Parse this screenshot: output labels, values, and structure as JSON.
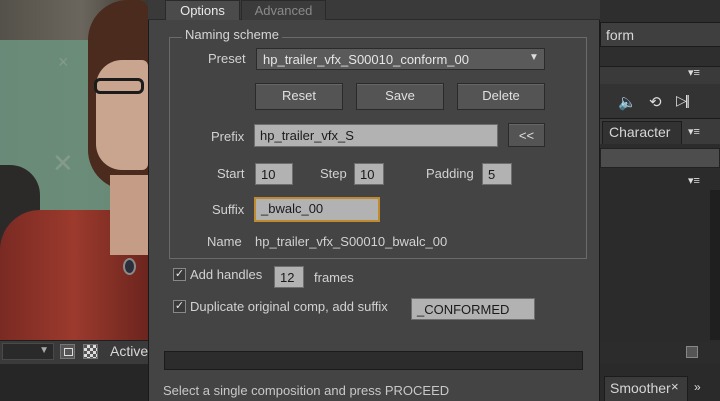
{
  "dialog": {
    "tabs": [
      {
        "label": "Options",
        "active": true
      },
      {
        "label": "Advanced",
        "active": false
      }
    ],
    "naming_scheme": {
      "title": "Naming scheme",
      "preset_label": "Preset",
      "preset_value": "hp_trailer_vfx_S00010_conform_00",
      "buttons": {
        "reset": "Reset",
        "save": "Save",
        "delete": "Delete"
      },
      "prefix_label": "Prefix",
      "prefix_value": "hp_trailer_vfx_S",
      "prefix_button": "<<",
      "start_label": "Start",
      "start_value": "10",
      "step_label": "Step",
      "step_value": "10",
      "padding_label": "Padding",
      "padding_value": "5",
      "suffix_label": "Suffix",
      "suffix_value": "_bwalc_00",
      "name_label": "Name",
      "name_value": "hp_trailer_vfx_S00010_bwalc_00"
    },
    "add_handles": {
      "checked": true,
      "check_mark": "✓",
      "label": "Add handles",
      "value": "12",
      "unit": "frames"
    },
    "duplicate": {
      "checked": true,
      "check_mark": "✓",
      "label": "Duplicate original comp, add suffix",
      "value": "_CONFORMED"
    },
    "progress": 0,
    "status": "Select a single composition and press PROCEED"
  },
  "background": {
    "right_panel": {
      "button_fragment": "form",
      "tab_character": "Character",
      "tab_smoother": "Smoother",
      "menu_glyph": "▾≡",
      "icons": {
        "speaker": "🔈",
        "loop": "⟲",
        "next": "▷||",
        "close": "×",
        "more": "»"
      }
    },
    "left_panel": {
      "active_fragment": "Active",
      "dropdown_arrow": "▼"
    },
    "webcam_marks": {
      "x1": "×",
      "x2": "✕"
    }
  },
  "colors": {
    "dialog_bg": "#444444",
    "field_bg": "#b2b2b2",
    "focus_border": "#c08a2e",
    "button_bg": "#545454"
  }
}
